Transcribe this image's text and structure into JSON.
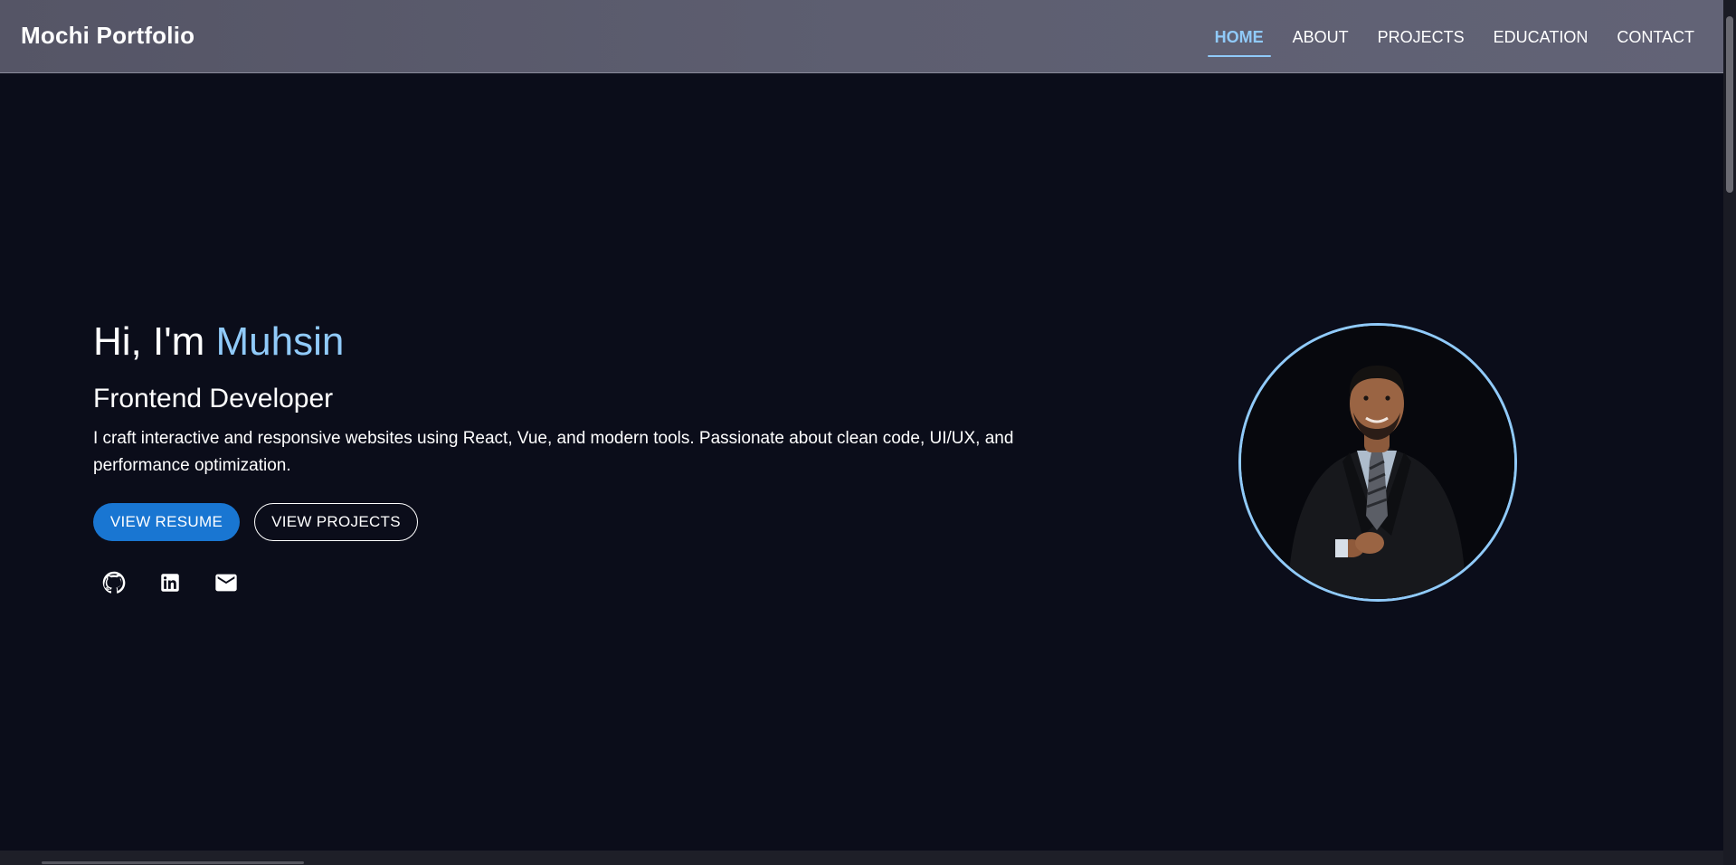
{
  "header": {
    "brand": "Mochi Portfolio",
    "nav": [
      {
        "label": "HOME",
        "active": true
      },
      {
        "label": "ABOUT",
        "active": false
      },
      {
        "label": "PROJECTS",
        "active": false
      },
      {
        "label": "EDUCATION",
        "active": false
      },
      {
        "label": "CONTACT",
        "active": false
      }
    ]
  },
  "hero": {
    "greeting_prefix": "Hi, I'm ",
    "name": "Muhsin",
    "role": "Frontend Developer",
    "bio": "I craft interactive and responsive websites using React, Vue, and modern tools. Passionate about clean code, UI/UX, and performance optimization.",
    "buttons": {
      "resume": "VIEW RESUME",
      "projects": "VIEW PROJECTS"
    },
    "social_icons": [
      "github-icon",
      "linkedin-icon",
      "email-icon"
    ]
  },
  "colors": {
    "background": "#0b0d1a",
    "accent": "#90caf9",
    "primary_button": "#1976d2",
    "header": "#5d5e70"
  }
}
